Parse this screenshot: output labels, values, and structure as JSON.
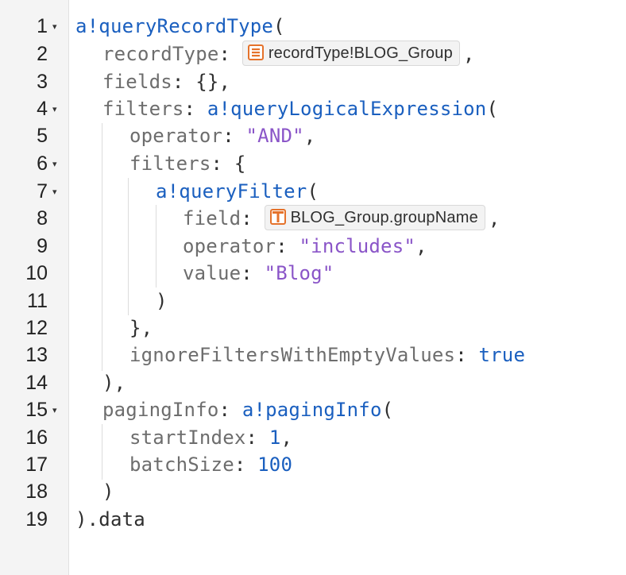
{
  "colors": {
    "function": "#1a5fbf",
    "key": "#6d6d6d",
    "string": "#8a55c8",
    "number": "#1a5fbf",
    "punctuation": "#2f2f2f",
    "record_icon": "#e5722b"
  },
  "gutter": {
    "line_numbers": [
      "1",
      "2",
      "3",
      "4",
      "5",
      "6",
      "7",
      "8",
      "9",
      "10",
      "11",
      "12",
      "13",
      "14",
      "15",
      "16",
      "17",
      "18",
      "19"
    ],
    "fold_glyph": "▾"
  },
  "code": {
    "l1": {
      "fn": "a!queryRecordType",
      "open": "("
    },
    "l2": {
      "key": "recordType",
      "colon": ":",
      "chip_label": "recordType!BLOG_Group",
      "chip_icon": "record-type-icon",
      "comma": ","
    },
    "l3": {
      "key": "fields",
      "colon": ":",
      "value": "{},"
    },
    "l4": {
      "key": "filters",
      "colon": ":",
      "fn": "a!queryLogicalExpression",
      "open": "("
    },
    "l5": {
      "key": "operator",
      "colon": ":",
      "str": "\"AND\"",
      "comma": ","
    },
    "l6": {
      "key": "filters",
      "colon": ":",
      "value": "{"
    },
    "l7": {
      "fn": "a!queryFilter",
      "open": "("
    },
    "l8": {
      "key": "field",
      "colon": ":",
      "chip_label": "BLOG_Group.groupName",
      "chip_icon": "record-field-icon",
      "comma": ","
    },
    "l9": {
      "key": "operator",
      "colon": ":",
      "str": "\"includes\"",
      "comma": ","
    },
    "l10": {
      "key": "value",
      "colon": ":",
      "str": "\"Blog\""
    },
    "l11": {
      "value": ")"
    },
    "l12": {
      "value": "},"
    },
    "l13": {
      "key": "ignoreFiltersWithEmptyValues",
      "colon": ":",
      "kw": "true"
    },
    "l14": {
      "value": "),"
    },
    "l15": {
      "key": "pagingInfo",
      "colon": ":",
      "fn": "a!pagingInfo",
      "open": "("
    },
    "l16": {
      "key": "startIndex",
      "colon": ":",
      "num": "1",
      "comma": ","
    },
    "l17": {
      "key": "batchSize",
      "colon": ":",
      "num": "100"
    },
    "l18": {
      "value": ")"
    },
    "l19": {
      "value": ").data"
    }
  }
}
